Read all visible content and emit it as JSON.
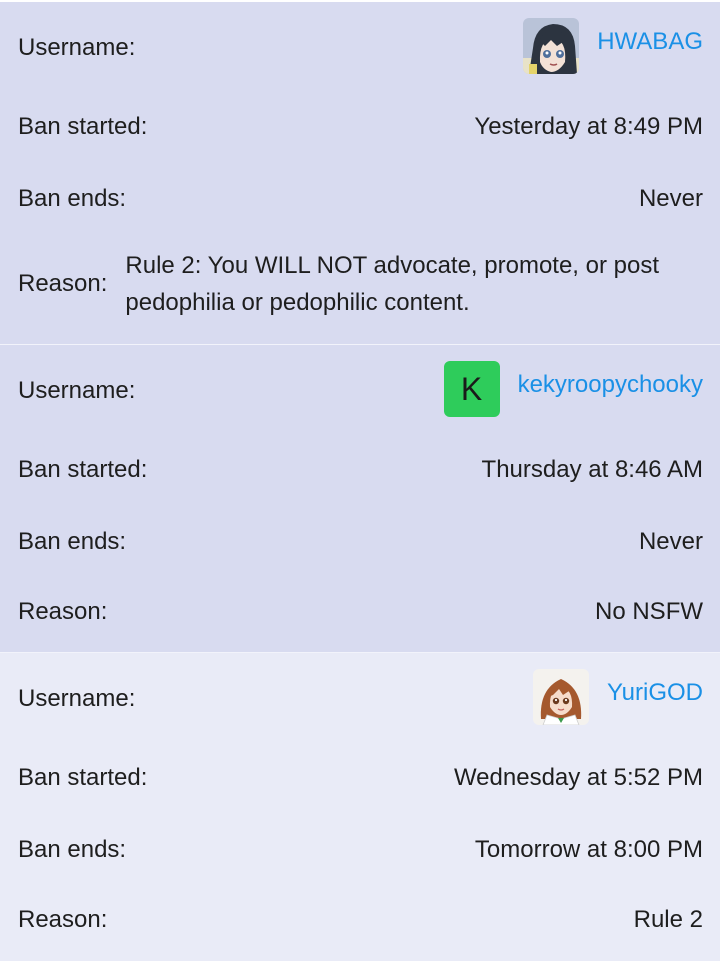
{
  "labels": {
    "username": "Username:",
    "ban_started": "Ban started:",
    "ban_ends": "Ban ends:",
    "reason": "Reason:"
  },
  "colors": {
    "username_link": "#1a90e6",
    "card_dark": "#d8dbf0",
    "card_light": "#e9ebf7",
    "letter_avatar": "#2ecc5b"
  },
  "bans": [
    {
      "username": "HWABAG",
      "avatar": "anime-character-avatar",
      "ban_started": "Yesterday at 8:49 PM",
      "ban_ends": "Never",
      "reason": "Rule 2: You WILL NOT advocate, promote, or post pedophilia or pedophilic content."
    },
    {
      "username": "kekyroopychooky",
      "avatar_letter": "K",
      "ban_started": "Thursday at 8:46 AM",
      "ban_ends": "Never",
      "reason": "No NSFW"
    },
    {
      "username": "YuriGOD",
      "avatar": "anime-girl-avatar",
      "ban_started": "Wednesday at 5:52 PM",
      "ban_ends": "Tomorrow at 8:00 PM",
      "reason": "Rule 2"
    }
  ]
}
